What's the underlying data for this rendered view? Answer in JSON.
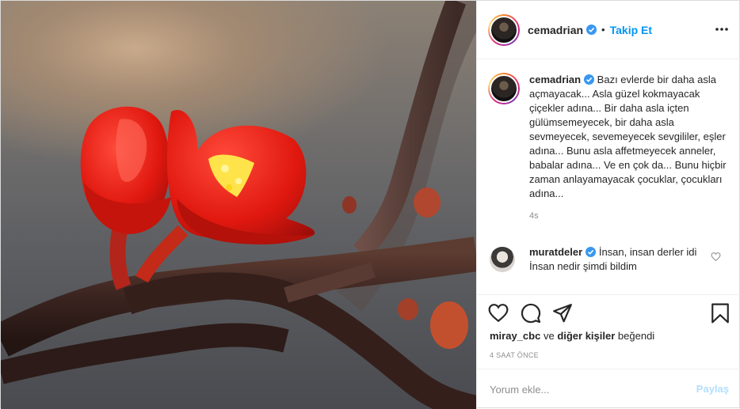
{
  "photo": {
    "alt": "red flowers on a branch"
  },
  "header": {
    "username": "cemadrian",
    "separator": "•",
    "follow_label": "Takip Et"
  },
  "caption": {
    "username": "cemadrian",
    "text": "Bazı evlerde bir daha asla açmayacak... Asla güzel kokmayacak çiçekler adına... Bir daha asla içten gülümsemeyecek, bir daha asla sevmeyecek, sevemeyecek sevgililer, eşler adına... Bunu asla affetmeyecek anneler, babalar adına... Ve en çok da... Bunu hiçbir zaman anlayamayacak çocuklar, çocukları adına...",
    "time": "4s"
  },
  "comment": {
    "username": "muratdeler",
    "line1": "İnsan, insan derler idi",
    "line2": "İnsan nedir şimdi bildim"
  },
  "likes": {
    "user": "miray_cbc",
    "connector": "ve",
    "others": "diğer kişiler",
    "suffix": "beğendi"
  },
  "post_time": "4 SAAT ÖNCE",
  "add_comment": {
    "placeholder": "Yorum ekle...",
    "post_label": "Paylaş"
  },
  "colors": {
    "accent": "#0095f6",
    "post_disabled": "#b2dffc",
    "muted": "#8e8e8e"
  },
  "icons": [
    "more-icon",
    "verified-icon",
    "heart-icon",
    "comment-icon",
    "share-icon",
    "bookmark-icon",
    "heart-small-icon"
  ]
}
